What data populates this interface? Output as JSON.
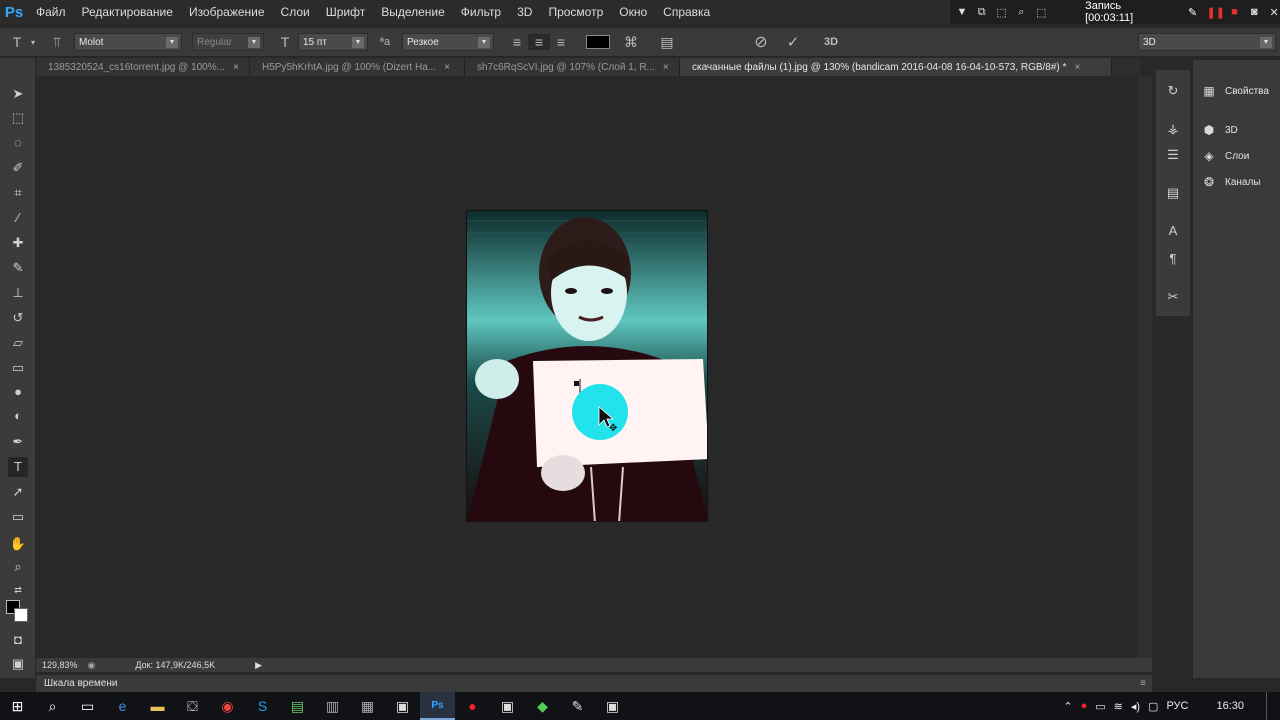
{
  "app": {
    "logo": "Ps"
  },
  "menu": [
    "Файл",
    "Редактирование",
    "Изображение",
    "Слои",
    "Шрифт",
    "Выделение",
    "Фильтр",
    "3D",
    "Просмотр",
    "Окно",
    "Справка"
  ],
  "recorder": {
    "title": "Запись [00:03:11]"
  },
  "options": {
    "font_family": "Molot",
    "font_style": "Regular",
    "font_size": "15 пт",
    "antialias": "Резкое",
    "mode_3d": "3D",
    "workspace": "3D",
    "text_color": "#000000"
  },
  "tabs": [
    {
      "label": "1385320524_cs16torrent.jpg @ 100%...",
      "close": "×"
    },
    {
      "label": "H5Py5hKrhtA.jpg @ 100% (Dizert На...",
      "close": "×"
    },
    {
      "label": "sh7c6RqScVI.jpg @ 107% (Слой 1, R...",
      "close": "×"
    },
    {
      "label": "скачанные файлы (1).jpg @ 130% (bandicam 2016-04-08 16-04-10-573, RGB/8#) *",
      "close": "×"
    }
  ],
  "status": {
    "zoom": "129,83%",
    "doc": "Док: 147,9K/246,5K"
  },
  "timeline": {
    "label": "Шкала времени"
  },
  "panels": [
    {
      "icon": "properties-icon",
      "label": "Свойства"
    },
    {
      "icon": "cube-icon",
      "label": "3D"
    },
    {
      "icon": "layers-icon",
      "label": "Слои"
    },
    {
      "icon": "channels-icon",
      "label": "Каналы"
    }
  ],
  "taskbar": {
    "lang": "РУС",
    "time": "16:30"
  }
}
